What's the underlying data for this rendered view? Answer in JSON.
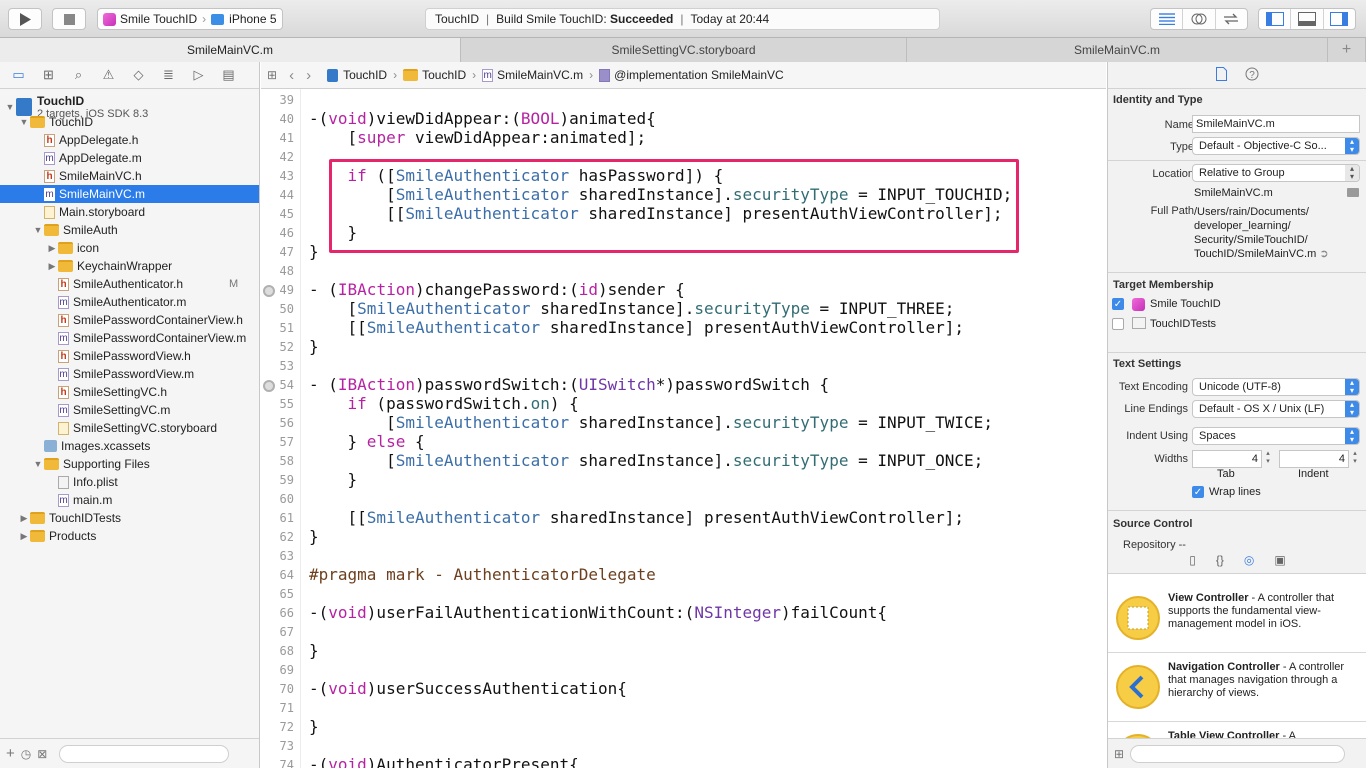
{
  "toolbar": {
    "run_icon": "play-icon",
    "stop_icon": "stop-icon",
    "scheme": {
      "app": "Smile TouchID",
      "device": "iPhone 5"
    },
    "status": {
      "project": "TouchID",
      "action": "Build Smile TouchID:",
      "result": "Succeeded",
      "time": "Today at 20:44"
    }
  },
  "tabs": [
    {
      "label": "SmileMainVC.m"
    },
    {
      "label": "SmileSettingVC.storyboard"
    },
    {
      "label": "SmileMainVC.m"
    }
  ],
  "tab_add": "+",
  "navigator": {
    "tree": [
      {
        "label": "TouchID",
        "sub": "2 targets, iOS SDK 8.3",
        "kind": "project"
      },
      {
        "label": "TouchID",
        "kind": "folder",
        "open": true
      },
      {
        "label": "AppDelegate.h",
        "kind": "h"
      },
      {
        "label": "AppDelegate.m",
        "kind": "m"
      },
      {
        "label": "SmileMainVC.h",
        "kind": "h"
      },
      {
        "label": "SmileMainVC.m",
        "kind": "m",
        "selected": true
      },
      {
        "label": "Main.storyboard",
        "kind": "sb"
      },
      {
        "label": "SmileAuth",
        "kind": "folder",
        "open": true
      },
      {
        "label": "icon",
        "kind": "folder"
      },
      {
        "label": "KeychainWrapper",
        "kind": "folder"
      },
      {
        "label": "SmileAuthenticator.h",
        "kind": "h",
        "badge": "M"
      },
      {
        "label": "SmileAuthenticator.m",
        "kind": "m"
      },
      {
        "label": "SmilePasswordContainerView.h",
        "kind": "h"
      },
      {
        "label": "SmilePasswordContainerView.m",
        "kind": "m"
      },
      {
        "label": "SmilePasswordView.h",
        "kind": "h"
      },
      {
        "label": "SmilePasswordView.m",
        "kind": "m"
      },
      {
        "label": "SmileSettingVC.h",
        "kind": "h"
      },
      {
        "label": "SmileSettingVC.m",
        "kind": "m"
      },
      {
        "label": "SmileSettingVC.storyboard",
        "kind": "sb"
      },
      {
        "label": "Images.xcassets",
        "kind": "xc"
      },
      {
        "label": "Supporting Files",
        "kind": "folder",
        "open": true
      },
      {
        "label": "Info.plist",
        "kind": "plist"
      },
      {
        "label": "main.m",
        "kind": "m"
      },
      {
        "label": "TouchIDTests",
        "kind": "folder"
      },
      {
        "label": "Products",
        "kind": "folder"
      }
    ]
  },
  "jumpbar": [
    "TouchID",
    "TouchID",
    "SmileMainVC.m",
    "@implementation SmileMainVC"
  ],
  "code": {
    "line_numbers": [
      "39",
      "40",
      "41",
      "42",
      "43",
      "44",
      "45",
      "46",
      "47",
      "48",
      "49",
      "50",
      "51",
      "52",
      "53",
      "54",
      "55",
      "56",
      "57",
      "58",
      "59",
      "60",
      "61",
      "62",
      "63",
      "64",
      "65",
      "66",
      "67",
      "68",
      "69",
      "70",
      "71",
      "72",
      "73",
      "74"
    ],
    "lines": [
      "",
      "-(void)viewDidAppear:(BOOL)animated{",
      "    [super viewDidAppear:animated];",
      "",
      "    if ([SmileAuthenticator hasPassword]) {",
      "        [SmileAuthenticator sharedInstance].securityType = INPUT_TOUCHID;",
      "        [[SmileAuthenticator sharedInstance] presentAuthViewController];",
      "    }",
      "}",
      "",
      "- (IBAction)changePassword:(id)sender {",
      "    [SmileAuthenticator sharedInstance].securityType = INPUT_THREE;",
      "    [[SmileAuthenticator sharedInstance] presentAuthViewController];",
      "}",
      "",
      "- (IBAction)passwordSwitch:(UISwitch*)passwordSwitch {",
      "    if (passwordSwitch.on) {",
      "        [SmileAuthenticator sharedInstance].securityType = INPUT_TWICE;",
      "    } else {",
      "        [SmileAuthenticator sharedInstance].securityType = INPUT_ONCE;",
      "    }",
      "",
      "    [[SmileAuthenticator sharedInstance] presentAuthViewController];",
      "}",
      "",
      "#pragma mark - AuthenticatorDelegate",
      "",
      "-(void)userFailAuthenticationWithCount:(NSInteger)failCount{",
      "",
      "}",
      "",
      "-(void)userSuccessAuthentication{",
      "",
      "}",
      "",
      "-(void)AuthenticatorPresent{"
    ]
  },
  "inspector": {
    "identity": {
      "title": "Identity and Type",
      "name_label": "Name",
      "name": "SmileMainVC.m",
      "type_label": "Type",
      "type": "Default - Objective-C So...",
      "location_label": "Location",
      "location": "Relative to Group",
      "location_file": "SmileMainVC.m",
      "fullpath_label": "Full Path",
      "fullpath": [
        "/Users/rain/Documents/",
        "developer_learning/",
        "Security/SmileTouchID/",
        "TouchID/SmileMainVC.m"
      ]
    },
    "target": {
      "title": "Target Membership",
      "items": [
        {
          "label": "Smile TouchID",
          "checked": true
        },
        {
          "label": "TouchIDTests",
          "checked": false
        }
      ]
    },
    "text": {
      "title": "Text Settings",
      "encoding_label": "Text Encoding",
      "encoding": "Unicode (UTF-8)",
      "endings_label": "Line Endings",
      "endings": "Default - OS X / Unix (LF)",
      "indent_label": "Indent Using",
      "indent": "Spaces",
      "widths_label": "Widths",
      "tab_width": "4",
      "indent_width": "4",
      "tab_caption": "Tab",
      "indent_caption": "Indent",
      "wrap_label": "Wrap lines"
    },
    "source": {
      "title": "Source Control",
      "repo_label": "Repository",
      "repo": "--"
    },
    "library": [
      {
        "title": "View Controller",
        "desc": "- A controller that supports the fundamental view-management model in iOS."
      },
      {
        "title": "Navigation Controller",
        "desc": "- A controller that manages navigation through a hierarchy of views."
      },
      {
        "title": "Table View Controller",
        "desc": "- A"
      }
    ]
  }
}
